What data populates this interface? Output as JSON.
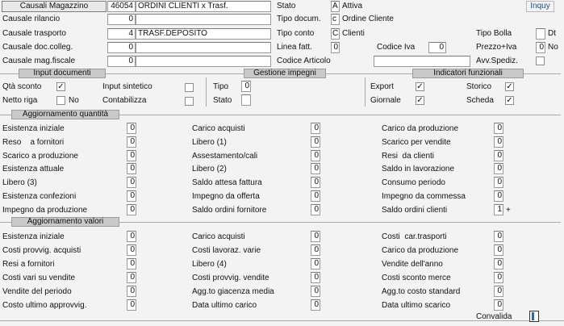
{
  "top": {
    "causali_button": "Causali Magazzino",
    "code": "46054",
    "description": "ORDINI CLIENTI x Trasf.",
    "inquy": "Inquy",
    "rows": [
      {
        "label": "Causale rilancio",
        "value": "0",
        "text": ""
      },
      {
        "label": "Causale trasporto",
        "value": "4",
        "text": "TRASF.DEPOSITO"
      },
      {
        "label": "Causale doc.colleg.",
        "value": "0",
        "text": ""
      },
      {
        "label": "Causale mag.fiscale",
        "value": "0",
        "text": ""
      }
    ],
    "stato": {
      "label": "Stato",
      "code": "A",
      "desc": "Attiva"
    },
    "tipo_docum": {
      "label": "Tipo docum.",
      "code": "c",
      "desc": "Ordine Cliente"
    },
    "tipo_conto": {
      "label": "Tipo conto",
      "code": "C",
      "desc": "Clienti"
    },
    "linea_fatt": {
      "label": "Linea fatt.",
      "value": "0"
    },
    "codice_iva": {
      "label": "Codice Iva",
      "value": "0"
    },
    "codice_articolo": {
      "label": "Codice Articolo",
      "value": ""
    },
    "tipo_bolla": {
      "label": "Tipo Bolla",
      "value": "",
      "suffix": "Dt"
    },
    "prezzo_iva": {
      "label": "Prezzo+Iva",
      "value": "0",
      "suffix": "No"
    },
    "avv_spediz": {
      "label": "Avv.Spediz.",
      "checked": ""
    }
  },
  "input_documenti": {
    "title": "Input documenti",
    "qta_sconto": {
      "label": "Qtà sconto",
      "mark": "✓"
    },
    "netto_riga": {
      "label": "Netto riga",
      "mark": "",
      "suffix": "No"
    },
    "input_sintetico": {
      "label": "Input sintetico",
      "mark": ""
    },
    "contabilizza": {
      "label": "Contabilizza",
      "mark": ""
    }
  },
  "gestione_impegni": {
    "title": "Gestione impegni",
    "tipo": {
      "label": "Tipo",
      "value": "0"
    },
    "stato": {
      "label": "Stato",
      "value": ""
    }
  },
  "indicatori": {
    "title": "Indicatori funzionali",
    "export": {
      "label": "Export",
      "mark": "✓"
    },
    "giornale": {
      "label": "Giornale",
      "mark": "✓"
    },
    "storico": {
      "label": "Storico",
      "mark": "✓"
    },
    "scheda": {
      "label": "Scheda",
      "mark": "✓"
    }
  },
  "agg_quantita": {
    "title": "Aggiornamento quantità",
    "col1": [
      {
        "label": "Esistenza iniziale",
        "value": "0"
      },
      {
        "label": "Reso    a fornitori",
        "value": "0"
      },
      {
        "label": "Scarico a produzione",
        "value": "0"
      },
      {
        "label": "Esistenza attuale",
        "value": "0"
      },
      {
        "label": "Libero (3)",
        "value": "0"
      },
      {
        "label": "Esistenza confezioni",
        "value": "0"
      },
      {
        "label": "Impegno da produzione",
        "value": "0"
      }
    ],
    "col2": [
      {
        "label": "Carico acquisti",
        "value": "0"
      },
      {
        "label": "Libero (1)",
        "value": "0"
      },
      {
        "label": "Assestamento/cali",
        "value": "0"
      },
      {
        "label": "Libero (2)",
        "value": "0"
      },
      {
        "label": "Saldo attesa fattura",
        "value": "0"
      },
      {
        "label": "Impegno da offerta",
        "value": "0"
      },
      {
        "label": "Saldo ordini fornitore",
        "value": "0"
      }
    ],
    "col3": [
      {
        "label": "Carico da produzione",
        "value": "0"
      },
      {
        "label": "Scarico per vendite",
        "value": "0"
      },
      {
        "label": "Resi  da clienti",
        "value": "0"
      },
      {
        "label": "Saldo in lavorazione",
        "value": "0"
      },
      {
        "label": "Consumo periodo",
        "value": "0"
      },
      {
        "label": "Impegno da commessa",
        "value": "0"
      },
      {
        "label": "Saldo ordini clienti",
        "value": "1",
        "suffix": "+"
      }
    ]
  },
  "agg_valori": {
    "title": "Aggiornamento valori",
    "col1": [
      {
        "label": "Esistenza iniziale",
        "value": "0"
      },
      {
        "label": "Costi provvig. acquisti",
        "value": "0"
      },
      {
        "label": "Resi a fornitori",
        "value": "0"
      },
      {
        "label": "Costi vari su vendite",
        "value": "0"
      },
      {
        "label": "Vendite del periodo",
        "value": "0"
      },
      {
        "label": "Costo ultimo approvvig.",
        "value": "0"
      }
    ],
    "col2": [
      {
        "label": "Carico acquisti",
        "value": "0"
      },
      {
        "label": "Costi lavoraz. varie",
        "value": "0"
      },
      {
        "label": "Libero (4)",
        "value": "0"
      },
      {
        "label": "Costi provvig. vendite",
        "value": "0"
      },
      {
        "label": "Agg.to giacenza media",
        "value": "0"
      },
      {
        "label": "Data ultimo carico",
        "value": "0"
      }
    ],
    "col3": [
      {
        "label": "Costi  car.trasporti",
        "value": "0"
      },
      {
        "label": "Carico da produzione",
        "value": "0"
      },
      {
        "label": "Vendite dell'anno",
        "value": "0"
      },
      {
        "label": "Costi sconto merce",
        "value": "0"
      },
      {
        "label": "Agg.to costo standard",
        "value": "0"
      },
      {
        "label": "Data ultimo scarico",
        "value": "0"
      }
    ]
  },
  "convalida": "Convalida"
}
